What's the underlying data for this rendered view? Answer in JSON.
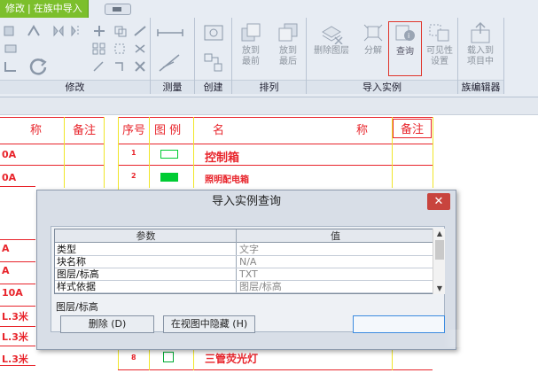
{
  "ribbon": {
    "context_tab": {
      "left": "修改",
      "sep": "|",
      "right": "在族中导入"
    },
    "panels": {
      "modify": "修改",
      "measure": "测量",
      "create": "创建",
      "arrange": "排列",
      "import_instance": "导入实例",
      "family_editor": "族编辑器"
    },
    "buttons": {
      "bring_front": [
        "放到",
        "最前"
      ],
      "send_back": [
        "放到",
        "最后"
      ],
      "delete_layer": "删除图层",
      "explode": "分解",
      "query": "查询",
      "visibility": [
        "可见性",
        "设置"
      ],
      "load_to_project": [
        "载入到",
        "项目中"
      ]
    }
  },
  "sheet": {
    "headers": {
      "left_name_tail": "称",
      "left_remark": "备注",
      "seq": "序号",
      "legend": "图  例",
      "name_head": "名",
      "name_tail": "称",
      "remark": "备注"
    },
    "left_cells": [
      "0A",
      "0A",
      "A",
      "A",
      "10A",
      "L.3米",
      "L.3米",
      "L.3米"
    ],
    "rows": [
      {
        "seq": "1",
        "name": "控制箱"
      },
      {
        "seq": "2",
        "name": "照明配电箱"
      },
      {
        "seq": "8",
        "name": "三管荧光灯"
      }
    ],
    "colors": {
      "accent": "#e8242b",
      "grid": "#f0e628",
      "swatch": "#00cc33"
    }
  },
  "dialog": {
    "title": "导入实例查询",
    "close": "✕",
    "table": {
      "col_param": "参数",
      "col_value": "值",
      "rows": [
        {
          "k": "类型",
          "v": "文字"
        },
        {
          "k": "块名称",
          "v": "N/A"
        },
        {
          "k": "图层/标高",
          "v": "TXT"
        },
        {
          "k": "样式依据",
          "v": "图层/标高"
        }
      ]
    },
    "group_label": "图层/标高",
    "delete_btn": "删除 (D)",
    "hide_btn": "在视图中隐藏 (H)",
    "scroll_up": "▲",
    "scroll_down": "▼"
  }
}
